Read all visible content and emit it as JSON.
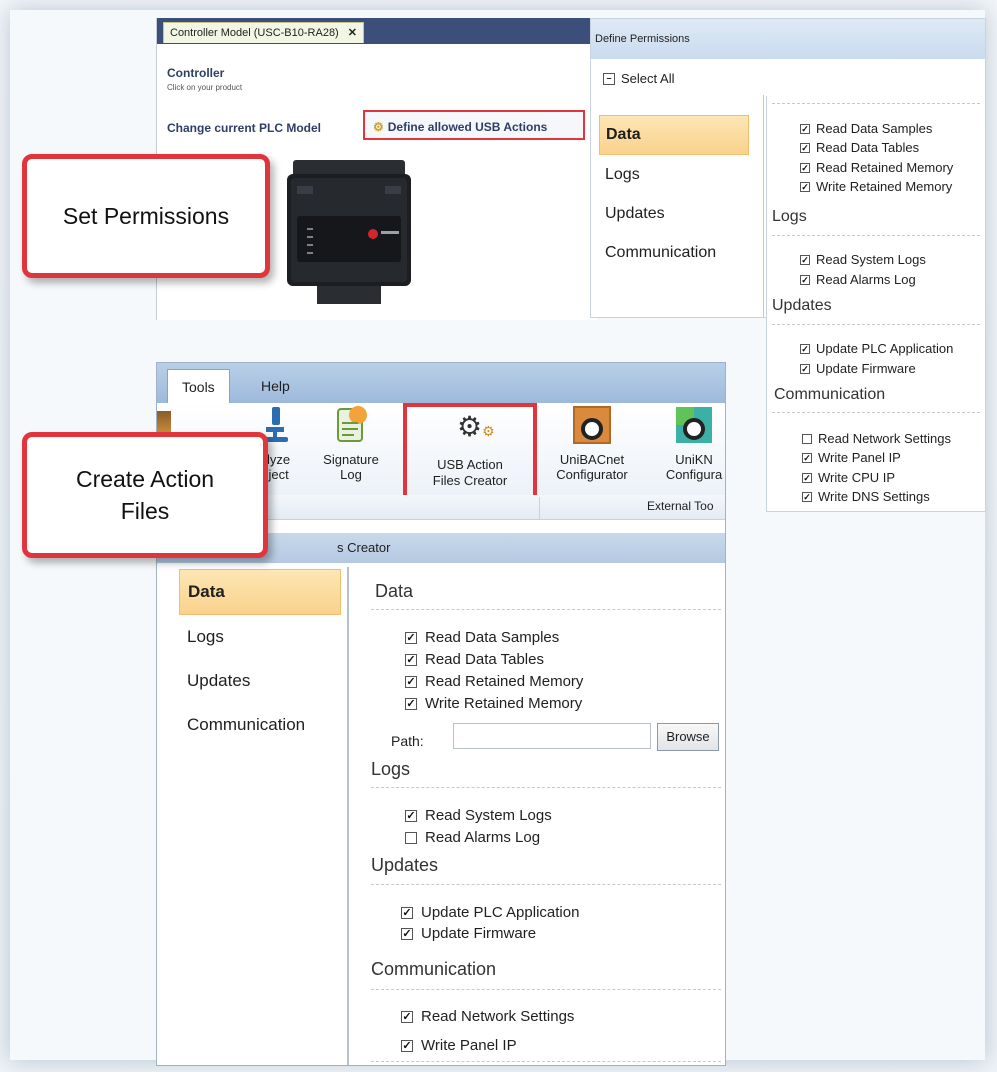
{
  "controller": {
    "tab_label": "Controller Model (USC-B10-RA28)",
    "tab_close": "✕",
    "heading": "Controller",
    "subheading": "Click on your product",
    "change_model": "Change current PLC Model",
    "define_usb_button": "Define allowed USB Actions"
  },
  "define_permissions": {
    "title": "Define Permissions",
    "select_all": "Select All",
    "categories": [
      "Data",
      "Logs",
      "Updates",
      "Communication"
    ],
    "sections": {
      "logs": "Logs",
      "updates": "Updates",
      "communication": "Communication"
    },
    "items": [
      {
        "label": "Read Data Samples",
        "checked": true
      },
      {
        "label": "Read Data Tables",
        "checked": true
      },
      {
        "label": "Read Retained Memory",
        "checked": true
      },
      {
        "label": "Write Retained Memory",
        "checked": true
      },
      {
        "label": "Read System Logs",
        "checked": true
      },
      {
        "label": "Read Alarms Log",
        "checked": true
      },
      {
        "label": "Update PLC Application",
        "checked": true
      },
      {
        "label": "Update Firmware",
        "checked": true
      },
      {
        "label": "Read Network Settings",
        "checked": false
      },
      {
        "label": "Write Panel IP",
        "checked": true
      },
      {
        "label": "Write CPU IP",
        "checked": true
      },
      {
        "label": "Write DNS Settings",
        "checked": true
      }
    ]
  },
  "ribbon": {
    "tabs": [
      "Tools",
      "Help"
    ],
    "items": {
      "analyze_1": "alyze",
      "analyze_2": "oject",
      "signature_1": "Signature",
      "signature_2": "Log",
      "usb_1": "USB Action",
      "usb_2": "Files  Creator",
      "unibacnet_1": "UniBACnet",
      "unibacnet_2": "Configurator",
      "uniknx_1": "UniKN",
      "uniknx_2": "Configura"
    },
    "group_label": "External Too"
  },
  "creator": {
    "title": "s  Creator",
    "categories": [
      "Data",
      "Logs",
      "Updates",
      "Communication"
    ],
    "sections": {
      "data": "Data",
      "logs": "Logs",
      "updates": "Updates",
      "communication": "Communication"
    },
    "items": [
      {
        "label": "Read Data Samples",
        "checked": true
      },
      {
        "label": "Read Data Tables",
        "checked": true
      },
      {
        "label": "Read Retained Memory",
        "checked": true
      },
      {
        "label": "Write Retained Memory",
        "checked": true
      },
      {
        "label": "Read System Logs",
        "checked": true
      },
      {
        "label": "Read Alarms Log",
        "checked": false
      },
      {
        "label": "Update PLC Application",
        "checked": true
      },
      {
        "label": "Update Firmware",
        "checked": true
      },
      {
        "label": "Read Network Settings",
        "checked": true
      },
      {
        "label": "Write Panel IP",
        "checked": true
      }
    ],
    "path_label": "Path:",
    "path_value": "",
    "browse": "Browse"
  },
  "callouts": {
    "set_permissions": "Set Permissions",
    "create_action_files_1": "Create Action",
    "create_action_files_2": "Files"
  },
  "colors": {
    "highlight_red": "#e0353d",
    "selected_category": "#f9d28c",
    "title_blue": "#3b4f7a"
  }
}
